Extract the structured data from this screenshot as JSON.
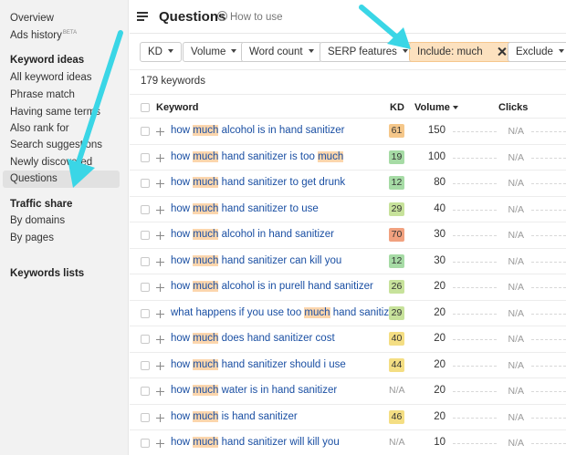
{
  "sidebar": {
    "overview": "Overview",
    "ads_history": "Ads history",
    "ads_history_badge": "BETA",
    "section_keyword_ideas": "Keyword ideas",
    "items": [
      "All keyword ideas",
      "Phrase match",
      "Having same terms",
      "Also rank for",
      "Search suggestions",
      "Newly discovered",
      "Questions"
    ],
    "section_traffic_share": "Traffic share",
    "traffic_items": [
      "By domains",
      "By pages"
    ],
    "section_keywords_lists": "Keywords lists"
  },
  "header": {
    "title": "Questions",
    "how_to_use": "How to use"
  },
  "filters": {
    "kd": "KD",
    "volume": "Volume",
    "word_count": "Word count",
    "serp_features": "SERP features",
    "include": "Include: much",
    "exclude": "Exclude"
  },
  "summary": {
    "count": "179 keywords"
  },
  "table": {
    "headers": {
      "keyword": "Keyword",
      "kd": "KD",
      "volume": "Volume",
      "clicks": "Clicks"
    },
    "rows": [
      {
        "pre": "how ",
        "hl": "much",
        "mid": " alcohol is in hand sanitizer",
        "hl2": "",
        "post": "",
        "kd": "61",
        "kd_color": "#f5c78a",
        "volume": "150",
        "clicks": "N/A"
      },
      {
        "pre": "how ",
        "hl": "much",
        "mid": " hand sanitizer is too ",
        "hl2": "much",
        "post": "",
        "kd": "19",
        "kd_color": "#a6dba5",
        "volume": "100",
        "clicks": "N/A"
      },
      {
        "pre": "how ",
        "hl": "much",
        "mid": " hand sanitizer to get drunk",
        "hl2": "",
        "post": "",
        "kd": "12",
        "kd_color": "#a6dba5",
        "volume": "80",
        "clicks": "N/A"
      },
      {
        "pre": "how ",
        "hl": "much",
        "mid": " hand sanitizer to use",
        "hl2": "",
        "post": "",
        "kd": "29",
        "kd_color": "#c7e29b",
        "volume": "40",
        "clicks": "N/A"
      },
      {
        "pre": "how ",
        "hl": "much",
        "mid": " alcohol in hand sanitizer",
        "hl2": "",
        "post": "",
        "kd": "70",
        "kd_color": "#f1a17f",
        "volume": "30",
        "clicks": "N/A"
      },
      {
        "pre": "how ",
        "hl": "much",
        "mid": " hand sanitizer can kill you",
        "hl2": "",
        "post": "",
        "kd": "12",
        "kd_color": "#a6dba5",
        "volume": "30",
        "clicks": "N/A"
      },
      {
        "pre": "how ",
        "hl": "much",
        "mid": " alcohol is in purell hand sanitizer",
        "hl2": "",
        "post": "",
        "kd": "26",
        "kd_color": "#c7e29b",
        "volume": "20",
        "clicks": "N/A"
      },
      {
        "pre": "what happens if you use too ",
        "hl": "much",
        "mid": " hand sanitizer",
        "hl2": "",
        "post": "",
        "kd": "29",
        "kd_color": "#c7e29b",
        "volume": "20",
        "clicks": "N/A"
      },
      {
        "pre": "how ",
        "hl": "much",
        "mid": " does hand sanitizer cost",
        "hl2": "",
        "post": "",
        "kd": "40",
        "kd_color": "#f4de83",
        "volume": "20",
        "clicks": "N/A"
      },
      {
        "pre": "how ",
        "hl": "much",
        "mid": " hand sanitizer should i use",
        "hl2": "",
        "post": "",
        "kd": "44",
        "kd_color": "#f4de83",
        "volume": "20",
        "clicks": "N/A"
      },
      {
        "pre": "how ",
        "hl": "much",
        "mid": " water is in hand sanitizer",
        "hl2": "",
        "post": "",
        "kd": "N/A",
        "kd_color": "",
        "volume": "20",
        "clicks": "N/A"
      },
      {
        "pre": "how ",
        "hl": "much",
        "mid": " is hand sanitizer",
        "hl2": "",
        "post": "",
        "kd": "46",
        "kd_color": "#f4de83",
        "volume": "20",
        "clicks": "N/A"
      },
      {
        "pre": "how ",
        "hl": "much",
        "mid": " hand sanitizer will kill you",
        "hl2": "",
        "post": "",
        "kd": "N/A",
        "kd_color": "",
        "volume": "10",
        "clicks": "N/A"
      }
    ]
  },
  "colors": {
    "annotation_arrow": "#3ad6e6",
    "include_bg": "#fce1bf",
    "link": "#1a4fa3"
  }
}
